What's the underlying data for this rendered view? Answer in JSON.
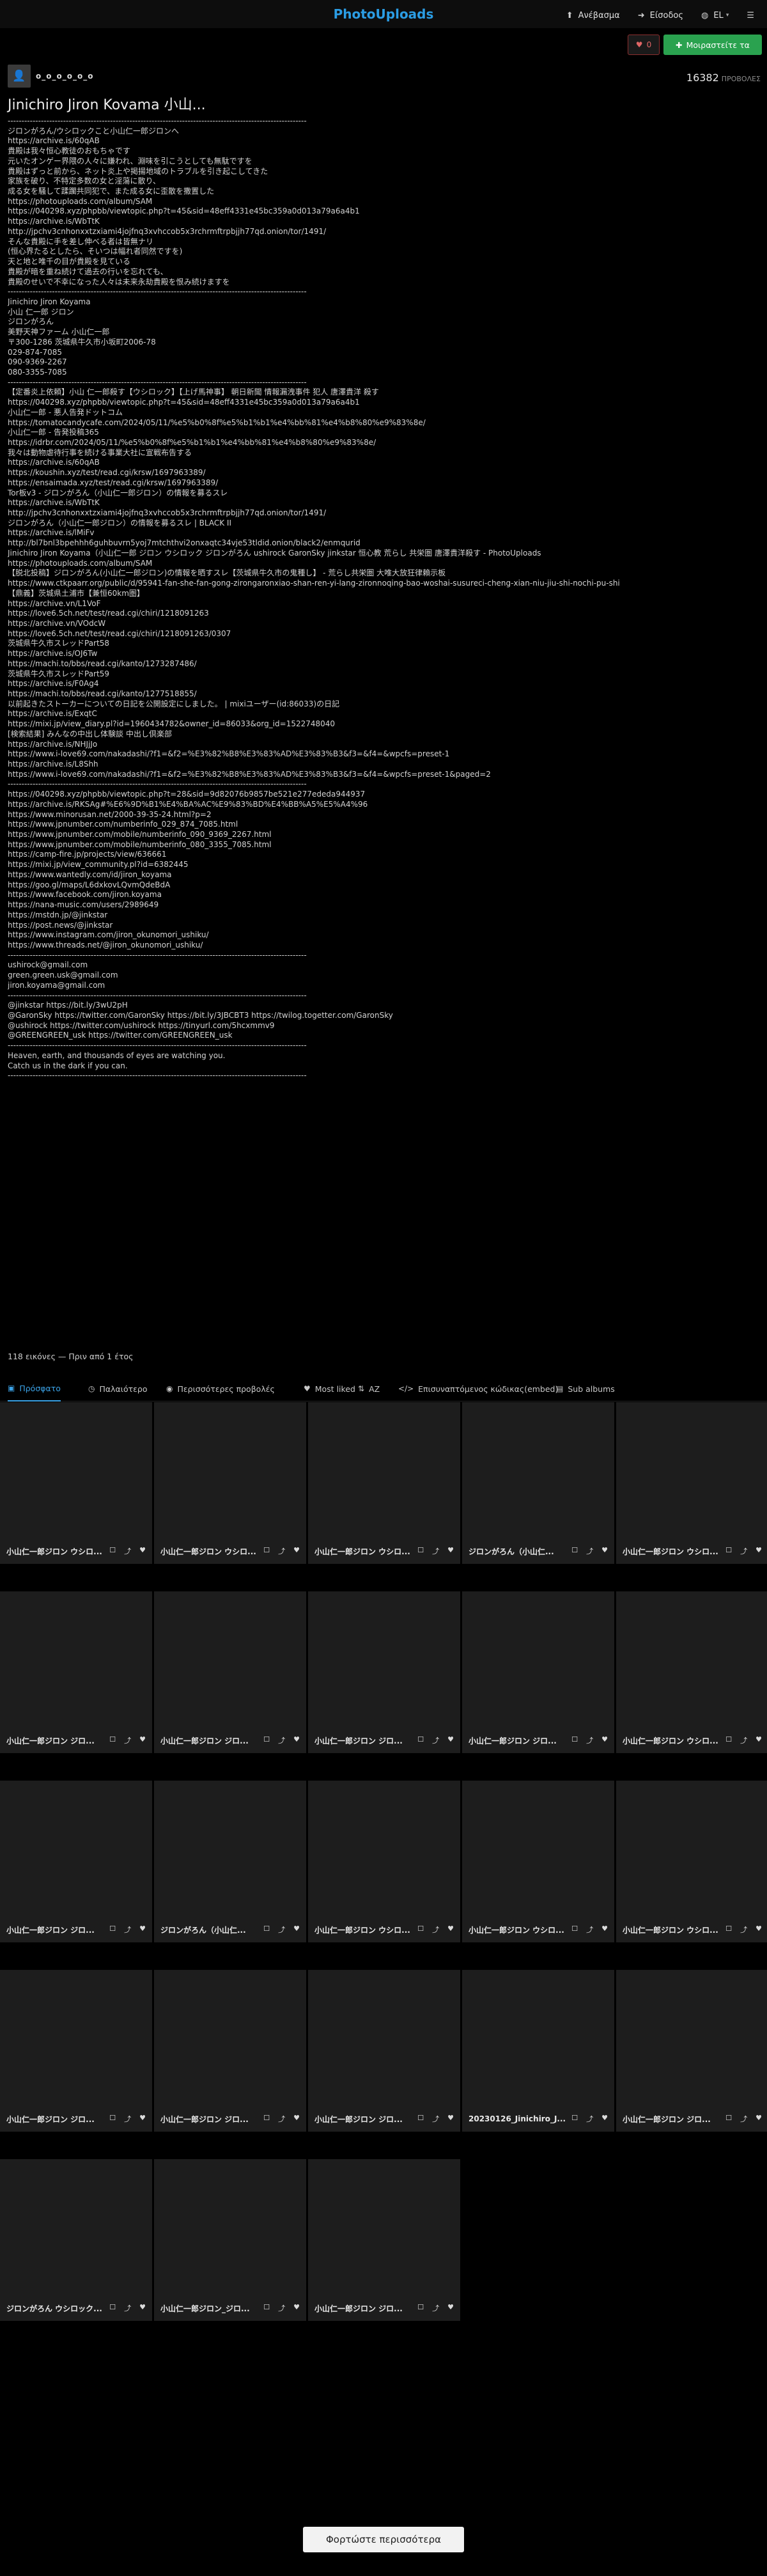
{
  "brand": {
    "logo_text": "PhotoUploads",
    "accent": "#2b9de4",
    "follow_color": "#2aa24f"
  },
  "topnav": {
    "items": [
      {
        "icon": "upload-icon",
        "glyph": "⬆",
        "label": "Ανέβασμα",
        "caret": ""
      },
      {
        "icon": "login-icon",
        "glyph": "➜",
        "label": "Είσοδος",
        "caret": ""
      },
      {
        "icon": "globe-icon",
        "glyph": "◍",
        "label": "EL",
        "caret": "▾"
      },
      {
        "icon": "menu-icon",
        "glyph": "☰",
        "label": "",
        "caret": ""
      }
    ]
  },
  "header": {
    "like": {
      "icon": "heart-icon",
      "glyph": "♥",
      "count": "0"
    },
    "follow": {
      "icon": "user-plus-icon",
      "glyph": "✚",
      "label": "Μοιραστείτε τα"
    }
  },
  "profile": {
    "avatar_glyph": "👤",
    "username": "o_o_o_o_o_o",
    "views_count": "16382",
    "views_label": "ΠΡΟΒΟΛΕΣ",
    "album_title": "Jinichiro Jiron Kovama 小山..."
  },
  "description": {
    "lines": [
      "------------------------------------------------------------------------------------------------------------",
      "ジロンがろん/ウシロックこと小山仁一郎ジロンへ",
      "https://archive.is/60qAB",
      "貴殿は我々恒心教徒のおもちゃです",
      "元いたオンゲー界隈の人々に嫌われ、淵味を引こうとしても無駄ですを",
      "貴殿はずっと前から、ネット炎上や掲揚地域のトラブルを引き起こしてきた",
      "家族を破り、不特定多数の女と淫蕩に散り、",
      "成る女を騒して蹂躙共同犯で、また成る女に歪散を撒置した",
      "https://photouploads.com/album/SAM",
      "https://040298.xyz/phpbb/viewtopic.php?t=45&sid=48eff4331e45bc359a0d013a79a6a4b1",
      "https://archive.is/WbTtK",
      "http://jpchv3cnhonxxtzxiami4jojfnq3xvhccob5x3rchrmftrpbjjh77qd.onion/tor/1491/",
      "そんな貴殿に手を差し伸べる者は皆無ナリ",
      "(恒心界たるとしたら、そいつは幅れ者同然ですを)",
      "天と地と唯千の目が貴殿を見ている",
      "貴殿が暗を重ね続けて過去の行いを忘れても、",
      "貴殿のせいで不幸になった人々は未来永劫貴殿を恨み続けますを",
      "------------------------------------------------------------------------------------------------------------",
      "Jinichiro Jiron Koyama",
      "小山 仁一郎 ジロン",
      "ジロンがろん",
      "美野天神ファーム 小山仁一郎",
      "〒300-1286 茨城県牛久市小坂町2006-78",
      "029-874-7085",
      "090-9369-2267",
      "080-3355-7085",
      "------------------------------------------------------------------------------------------------------------",
      "【定番炎上依頼】小山 仁一郎殺す【ウシロック】【上げ馬神事】 朝日新聞 情報漏洩事件 犯人 唐澤貴洋 殺す",
      "https://040298.xyz/phpbb/viewtopic.php?t=45&sid=48eff4331e45bc359a0d013a79a6a4b1",
      "小山仁一郎 - 悪人告発ドットコム",
      "https://tomatocandycafe.com/2024/05/11/%e5%b0%8f%e5%b1%b1%e4%bb%81%e4%b8%80%e9%83%8e/",
      "小山仁一郎 - 告発投稿365",
      "https://idrbr.com/2024/05/11/%e5%b0%8f%e5%b1%b1%e4%bb%81%e4%b8%80%e9%83%8e/",
      "我々は動物虐待行事を続ける事業大社に宣戦布告する",
      "https://archive.is/60qAB",
      "https://koushin.xyz/test/read.cgi/krsw/1697963389/",
      "https://ensaimada.xyz/test/read.cgi/krsw/1697963389/",
      "Tor板v3 - ジロンがろん（小山仁一郎ジロン）の情報を募るスレ",
      "https://archive.is/WbTtK",
      "http://jpchv3cnhonxxtzxiami4jojfnq3xvhccob5x3rchrmftrpbjjh77qd.onion/tor/1491/",
      "ジロンがろん（小山仁一郎ジロン）の情報を募るスレ | BLACK II",
      "https://archive.is/lMiFv",
      "http://bl7bnl3bpehhh6guhbuvrn5yoj7mtchthvi2onxaqtc34vje53tldid.onion/black2/enmqurid",
      "Jinichiro Jiron Koyama（小山仁一郎 ジロン ウシロック ジロンがろん ushirock GaronSky jinkstar 恒心教 荒らし 共栄圏 唐澤貴洋殺す - PhotoUploads",
      "https://photouploads.com/album/SAM",
      "【脱北投稿】ジロンがろん(小山仁一郎ジロン)の情報を晒すスレ【茨城県牛久市の鬼種し】 - 荒らし共栄圏 大唯大放狂律賴示板",
      "https://www.ctkpaarr.org/public/d/95941-fan-she-fan-gong-zirongaronxiao-shan-ren-yi-lang-zironnoqing-bao-woshai-susureci-cheng-xian-niu-jiu-shi-nochi-pu-shi",
      "【鼎義】茨城県土浦市【兼恒60km圏】",
      "https://archive.vn/L1VoF",
      "https://love6.5ch.net/test/read.cgi/chiri/1218091263",
      "https://archive.vn/VOdcW",
      "https://love6.5ch.net/test/read.cgi/chiri/1218091263/0307",
      "茨城県牛久市スレッドPart58",
      "https://archive.is/OJ6Tw",
      "https://machi.to/bbs/read.cgi/kanto/1273287486/",
      "茨城県牛久市スレッドPart59",
      "https://archive.is/F0Ag4",
      "https://machi.to/bbs/read.cgi/kanto/1277518855/",
      "以前起きたストーカーについての日記を公開設定にしました。 | mixiユーザー(id:86033)の日記",
      "https://archive.is/ExqtC",
      "https://mixi.jp/view_diary.pl?id=1960434782&owner_id=86033&org_id=1522748040",
      "[検索結果] みんなの中出し体験談 中出し倶楽部",
      "https://archive.is/NHJjJo",
      "https://www.i-love69.com/nakadashi/?f1=&f2=%E3%82%B8%E3%83%AD%E3%83%B3&f3=&f4=&wpcfs=preset-1",
      "https://archive.is/L8Shh",
      "https://www.i-love69.com/nakadashi/?f1=&f2=%E3%82%B8%E3%83%AD%E3%83%B3&f3=&f4=&wpcfs=preset-1&paged=2",
      "------------------------------------------------------------------------------------------------------------",
      "https://040298.xyz/phpbb/viewtopic.php?t=28&sid=9d82076b9857be521e277ededa944937",
      "https://archive.is/RKSAg#%E6%9D%B1%E4%BA%AC%E9%83%BD%E4%BB%A5%E5%A4%96",
      "https://www.minorusan.net/2000-39-35-24.html?p=2",
      "https://www.jpnumber.com/numberinfo_029_874_7085.html",
      "https://www.jpnumber.com/mobile/numberinfo_090_9369_2267.html",
      "https://www.jpnumber.com/mobile/numberinfo_080_3355_7085.html",
      "https://camp-fire.jp/projects/view/636661",
      "https://mixi.jp/view_community.pl?id=6382445",
      "https://www.wantedly.com/id/jiron_koyama",
      "https://goo.gl/maps/L6dxkovLQvmQdeBdA",
      "https://www.facebook.com/jiron.koyama",
      "https://nana-music.com/users/2989649",
      "https://mstdn.jp/@jinkstar",
      "https://post.news/@jinkstar",
      "https://www.instagram.com/jiron_okunomori_ushiku/",
      "https://www.threads.net/@jiron_okunomori_ushiku/",
      "------------------------------------------------------------------------------------------------------------",
      "ushirock@gmail.com",
      "green.green.usk@gmail.com",
      "jiron.koyama@gmail.com",
      "------------------------------------------------------------------------------------------------------------",
      "@jinkstar https://bit.ly/3wU2pH",
      "@GaronSky https://twitter.com/GaronSky https://bit.ly/3JBCBT3 https://twilog.togetter.com/GaronSky",
      "@ushirock https://twitter.com/ushirock https://tinyurl.com/5hcxmmv9",
      "@GREENGREEN_usk https://twitter.com/GREENGREEN_usk",
      "------------------------------------------------------------------------------------------------------------",
      "Heaven, earth, and thousands of eyes are watching you.",
      "Catch us in the dark if you can.",
      "------------------------------------------------------------------------------------------------------------"
    ]
  },
  "meta_line": "118 εικόνες — Πριν από 1 έτος",
  "tabs": [
    {
      "icon": "image-icon",
      "glyph": "▣",
      "label": "Πρόσφατο",
      "active": true
    },
    {
      "icon": "history-icon",
      "glyph": "◷",
      "label": "Παλαιότερο",
      "active": false
    },
    {
      "icon": "eye-icon",
      "glyph": "◉",
      "label": "Περισσότερες προβολές",
      "active": false
    },
    {
      "icon": "heart-icon",
      "glyph": "♥",
      "label": "Most liked",
      "active": false
    },
    {
      "icon": "sort-icon",
      "glyph": "⇅",
      "label": "AZ",
      "active": false
    },
    {
      "icon": "code-icon",
      "glyph": "</>",
      "label": "Επισυναπτόμενος κώδικας(embed)",
      "active": false
    },
    {
      "icon": "folder-icon",
      "glyph": "▤",
      "label": "Sub albums",
      "active": false
    }
  ],
  "grid": {
    "items": [
      {
        "name": "小山仁一郎ジロン ウシロ..."
      },
      {
        "name": "小山仁一郎ジロン ウシロ..."
      },
      {
        "name": "小山仁一郎ジロン ウシロ..."
      },
      {
        "name": "ジロンがろん（小山仁..."
      },
      {
        "name": "小山仁一郎ジロン ウシロ..."
      },
      {
        "name": "小山仁一郎ジロン ジロ..."
      },
      {
        "name": "小山仁一郎ジロン ジロ..."
      },
      {
        "name": "小山仁一郎ジロン ジロ..."
      },
      {
        "name": "小山仁一郎ジロン ジロ..."
      },
      {
        "name": "小山仁一郎ジロン ウシロ..."
      },
      {
        "name": "小山仁一郎ジロン ジロ..."
      },
      {
        "name": "ジロンがろん（小山仁..."
      },
      {
        "name": "小山仁一郎ジロン ウシロ..."
      },
      {
        "name": "小山仁一郎ジロン ウシロ..."
      },
      {
        "name": "小山仁一郎ジロン ウシロ..."
      },
      {
        "name": "小山仁一郎ジロン ジロ..."
      },
      {
        "name": "小山仁一郎ジロン ジロ..."
      },
      {
        "name": "小山仁一郎ジロン ジロ..."
      },
      {
        "name": "20230126_Jinichiro_J..."
      },
      {
        "name": "小山仁一郎ジロン ジロ..."
      },
      {
        "name": "ジロンがろん ウシロック..."
      },
      {
        "name": "小山仁一郎ジロン_ジロ..."
      },
      {
        "name": "小山仁一郎ジロン ジロ..."
      }
    ],
    "actions": [
      {
        "icon": "select-icon",
        "glyph": "☐"
      },
      {
        "icon": "share-icon",
        "glyph": "⤴"
      },
      {
        "icon": "heart-icon",
        "glyph": "♥"
      }
    ]
  },
  "load_more_label": "Φορτώστε περισσότερα"
}
